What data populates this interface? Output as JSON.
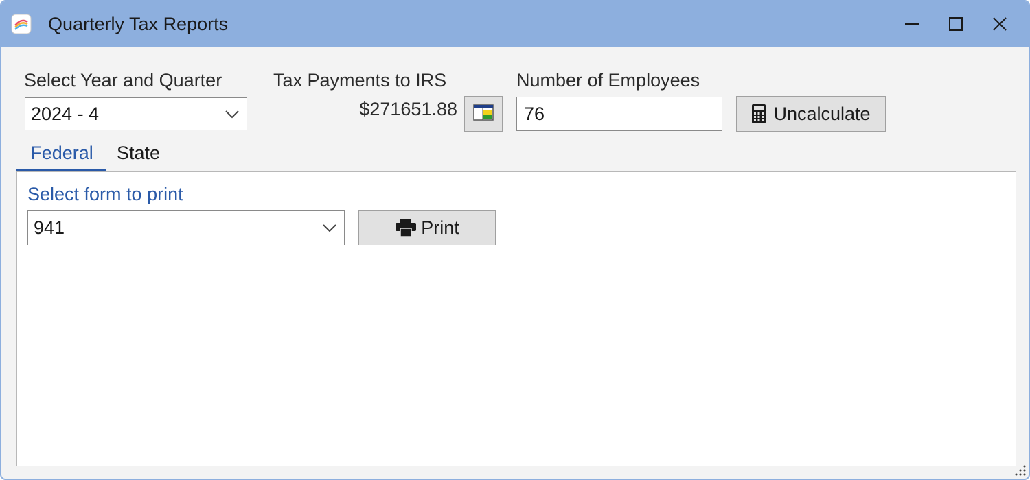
{
  "window": {
    "title": "Quarterly Tax Reports",
    "controls": {
      "minimize_icon": "minimize-icon",
      "maximize_icon": "maximize-icon",
      "close_icon": "close-icon"
    }
  },
  "header": {
    "year_quarter_label": "Select Year and Quarter",
    "year_quarter_value": "2024 - 4",
    "irs_label": "Tax Payments to IRS",
    "irs_amount": "$271651.88",
    "employees_label": "Number of Employees",
    "employees_value": "76",
    "uncalculate_label": "Uncalculate"
  },
  "tabs": [
    {
      "label": "Federal",
      "active": true
    },
    {
      "label": "State",
      "active": false
    }
  ],
  "federal": {
    "select_form_label": "Select form to print",
    "form_value": "941",
    "print_label": "Print"
  },
  "colors": {
    "titlebar": "#8dafde",
    "accent": "#2a5aa8",
    "button_bg": "#e1e1e1",
    "window_bg": "#f3f3f3"
  }
}
